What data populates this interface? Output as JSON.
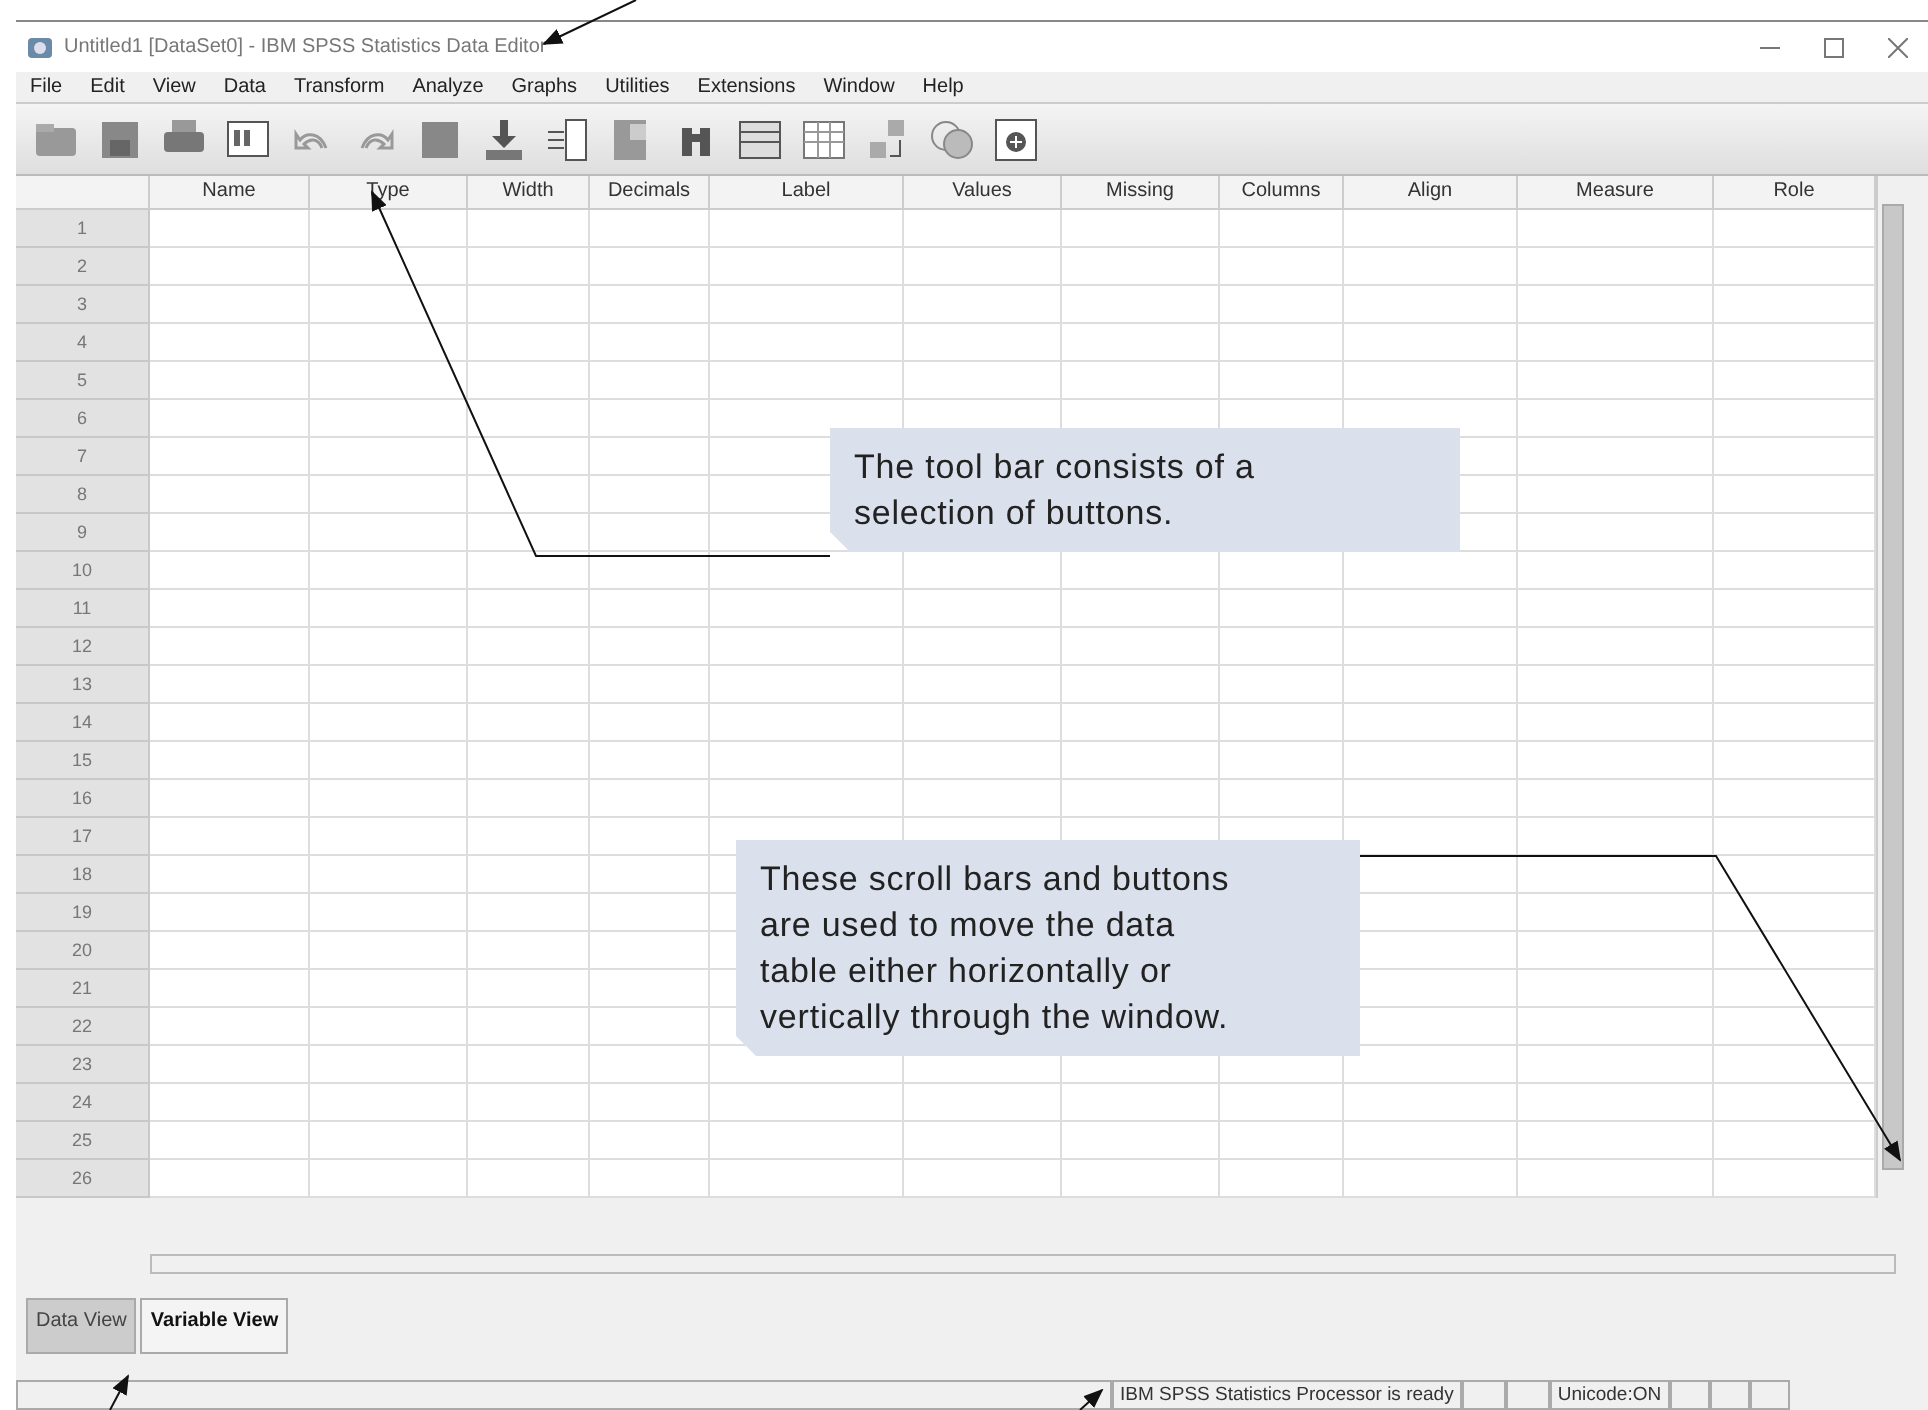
{
  "window": {
    "title": "Untitled1 [DataSet0] - IBM SPSS Statistics Data Editor"
  },
  "menu": [
    {
      "label": "File"
    },
    {
      "label": "Edit"
    },
    {
      "label": "View"
    },
    {
      "label": "Data"
    },
    {
      "label": "Transform"
    },
    {
      "label": "Analyze"
    },
    {
      "label": "Graphs"
    },
    {
      "label": "Utilities"
    },
    {
      "label": "Extensions"
    },
    {
      "label": "Window"
    },
    {
      "label": "Help"
    }
  ],
  "table": {
    "columns": [
      "Name",
      "Type",
      "Width",
      "Decimals",
      "Label",
      "Values",
      "Missing",
      "Columns",
      "Align",
      "Measure",
      "Role"
    ],
    "rows": [
      "1",
      "2",
      "3",
      "4",
      "5",
      "6",
      "7",
      "8",
      "9",
      "10",
      "11",
      "12",
      "13",
      "14",
      "15",
      "16",
      "17",
      "18",
      "19",
      "20",
      "21",
      "22",
      "23",
      "24",
      "25",
      "26"
    ]
  },
  "tabs": [
    {
      "label": "Data View",
      "selected": false
    },
    {
      "label": "Variable View",
      "selected": true
    }
  ],
  "status_bar": [
    "IBM SPSS Statistics Processor is ready",
    "Unicode:ON"
  ],
  "annotations": [
    {
      "text": "The tool bar consists of a selection of buttons."
    },
    {
      "text": "These scroll bars and buttons are used to move the data table either horizontally or vertically through the window."
    }
  ]
}
